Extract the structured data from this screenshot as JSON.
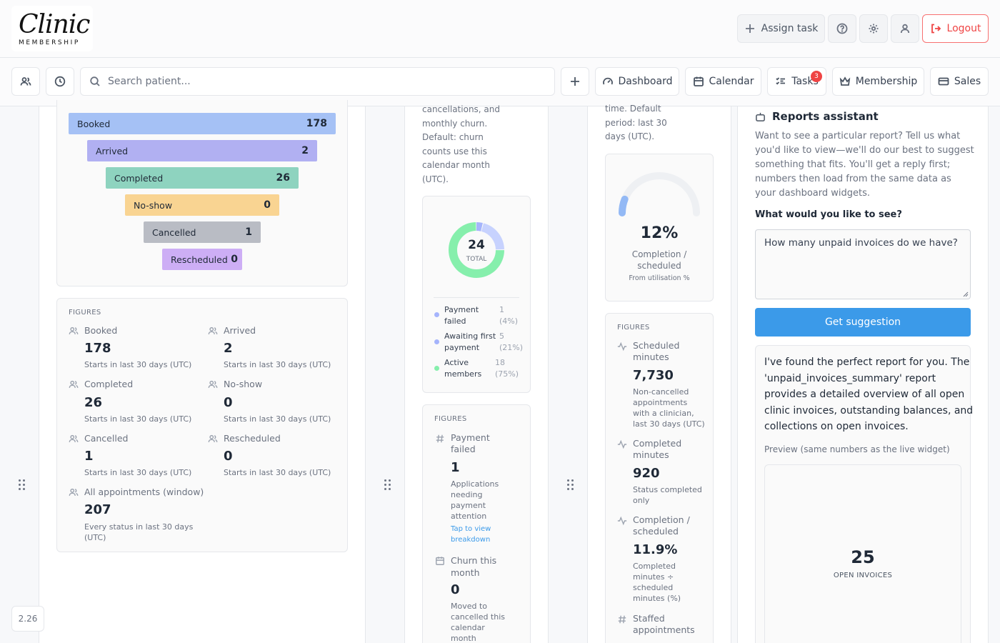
{
  "brand": {
    "script": "Clinic",
    "sub": "MEMBERSHIP"
  },
  "header": {
    "assign_task": "Assign task",
    "logout": "Logout"
  },
  "toolbar": {
    "search_placeholder": "Search patient...",
    "dashboard": "Dashboard",
    "calendar": "Calendar",
    "tasks": "Tasks",
    "tasks_badge": "3",
    "membership": "Membership",
    "sales": "Sales"
  },
  "version": "2.26",
  "appointments": {
    "funnel": [
      {
        "label": "Booked",
        "value": "178",
        "color": "#a5c1f5"
      },
      {
        "label": "Arrived",
        "value": "2",
        "color": "#b1b0f2"
      },
      {
        "label": "Completed",
        "value": "26",
        "color": "#8ed3bf"
      },
      {
        "label": "No-show",
        "value": "0",
        "color": "#f9d492"
      },
      {
        "label": "Cancelled",
        "value": "1",
        "color": "#b9bcc4"
      },
      {
        "label": "Rescheduled",
        "value": "0",
        "color": "#cdaef5"
      }
    ],
    "figures_title": "FIGURES",
    "figures": [
      {
        "label": "Booked",
        "value": "178",
        "sub": "Starts in last 30 days (UTC)"
      },
      {
        "label": "Arrived",
        "value": "2",
        "sub": "Starts in last 30 days (UTC)"
      },
      {
        "label": "Completed",
        "value": "26",
        "sub": "Starts in last 30 days (UTC)"
      },
      {
        "label": "No-show",
        "value": "0",
        "sub": "Starts in last 30 days (UTC)"
      },
      {
        "label": "Cancelled",
        "value": "1",
        "sub": "Starts in last 30 days (UTC)"
      },
      {
        "label": "Rescheduled",
        "value": "0",
        "sub": "Starts in last 30 days (UTC)"
      },
      {
        "label": "All appointments (window)",
        "value": "207",
        "sub1": "Every status in last 30 days",
        "sub2": "(UTC)"
      }
    ]
  },
  "membership": {
    "desc": [
      "cancellations, and",
      "monthly churn.",
      "Default: churn",
      "counts use this",
      "calendar month",
      "(UTC)."
    ],
    "donut": {
      "total": "24",
      "total_label": "TOTAL",
      "segments": [
        {
          "value": 1,
          "color": "#a5b4fc"
        },
        {
          "value": 5,
          "color": "#c7d2fe"
        },
        {
          "value": 18,
          "color": "#86efac"
        }
      ]
    },
    "legend": [
      {
        "l1": "Payment",
        "l2": "failed",
        "n": "1",
        "p": "(4%)",
        "color": "#a5b4fc"
      },
      {
        "l1": "Awaiting first",
        "l2": "payment",
        "n": "5",
        "p": "(21%)",
        "color": "#a5b4fc"
      },
      {
        "l1": "Active",
        "l2": "members",
        "n": "18",
        "p": "(75%)",
        "color": "#86efac"
      }
    ],
    "figures_title": "FIGURES",
    "fig1": {
      "l1": "Payment",
      "l2": "failed",
      "value": "1",
      "sub": [
        "Applications",
        "needing",
        "payment",
        "attention"
      ],
      "link": [
        "Tap to view",
        "breakdown"
      ]
    },
    "fig2": {
      "l1": "Churn this",
      "l2": "month",
      "value": "0",
      "sub": [
        "Moved to",
        "cancelled this",
        "calendar",
        "month"
      ]
    }
  },
  "utilisation": {
    "desc": [
      "time. Default",
      "period: last 30",
      "days (UTC)."
    ],
    "gauge": {
      "percent": 12,
      "value": "12%",
      "l1": "Completion /",
      "l2": "scheduled",
      "sub": "From utilisation %"
    },
    "figures_title": "FIGURES",
    "fig1": {
      "l1": "Scheduled",
      "l2": "minutes",
      "value": "7,730",
      "sub": [
        "Non-cancelled",
        "appointments",
        "with a clinician,",
        "last 30 days (UTC)"
      ]
    },
    "fig2": {
      "l1": "Completed",
      "l2": "minutes",
      "value": "920",
      "sub": [
        "Status completed",
        "only"
      ]
    },
    "fig3": {
      "l1": "Completion /",
      "l2": "scheduled",
      "value": "11.9%",
      "sub": [
        "Completed",
        "minutes ÷",
        "scheduled",
        "minutes (%)"
      ]
    },
    "fig4": {
      "l1": "Staffed",
      "l2": "appointments"
    }
  },
  "assistant": {
    "title": "Reports assistant",
    "intro": [
      "Want to see a particular report? Tell us what",
      "you'd like to view—we'll do our best to suggest",
      "something that fits. You'll get a reply first;",
      "numbers then load from the same data as",
      "your dashboard widgets."
    ],
    "question": "What would you like to see?",
    "query": "How many unpaid invoices do we have?",
    "button": "Get suggestion",
    "reply": [
      "I've found the perfect report for you. The",
      "'unpaid_invoices_summary' report",
      "provides a detailed overview of all open",
      "clinic invoices, outstanding balances, and",
      "collections on open invoices."
    ],
    "preview_label": "Preview (same numbers as the live widget)",
    "preview_value": "25",
    "preview_caption": "OPEN INVOICES"
  }
}
